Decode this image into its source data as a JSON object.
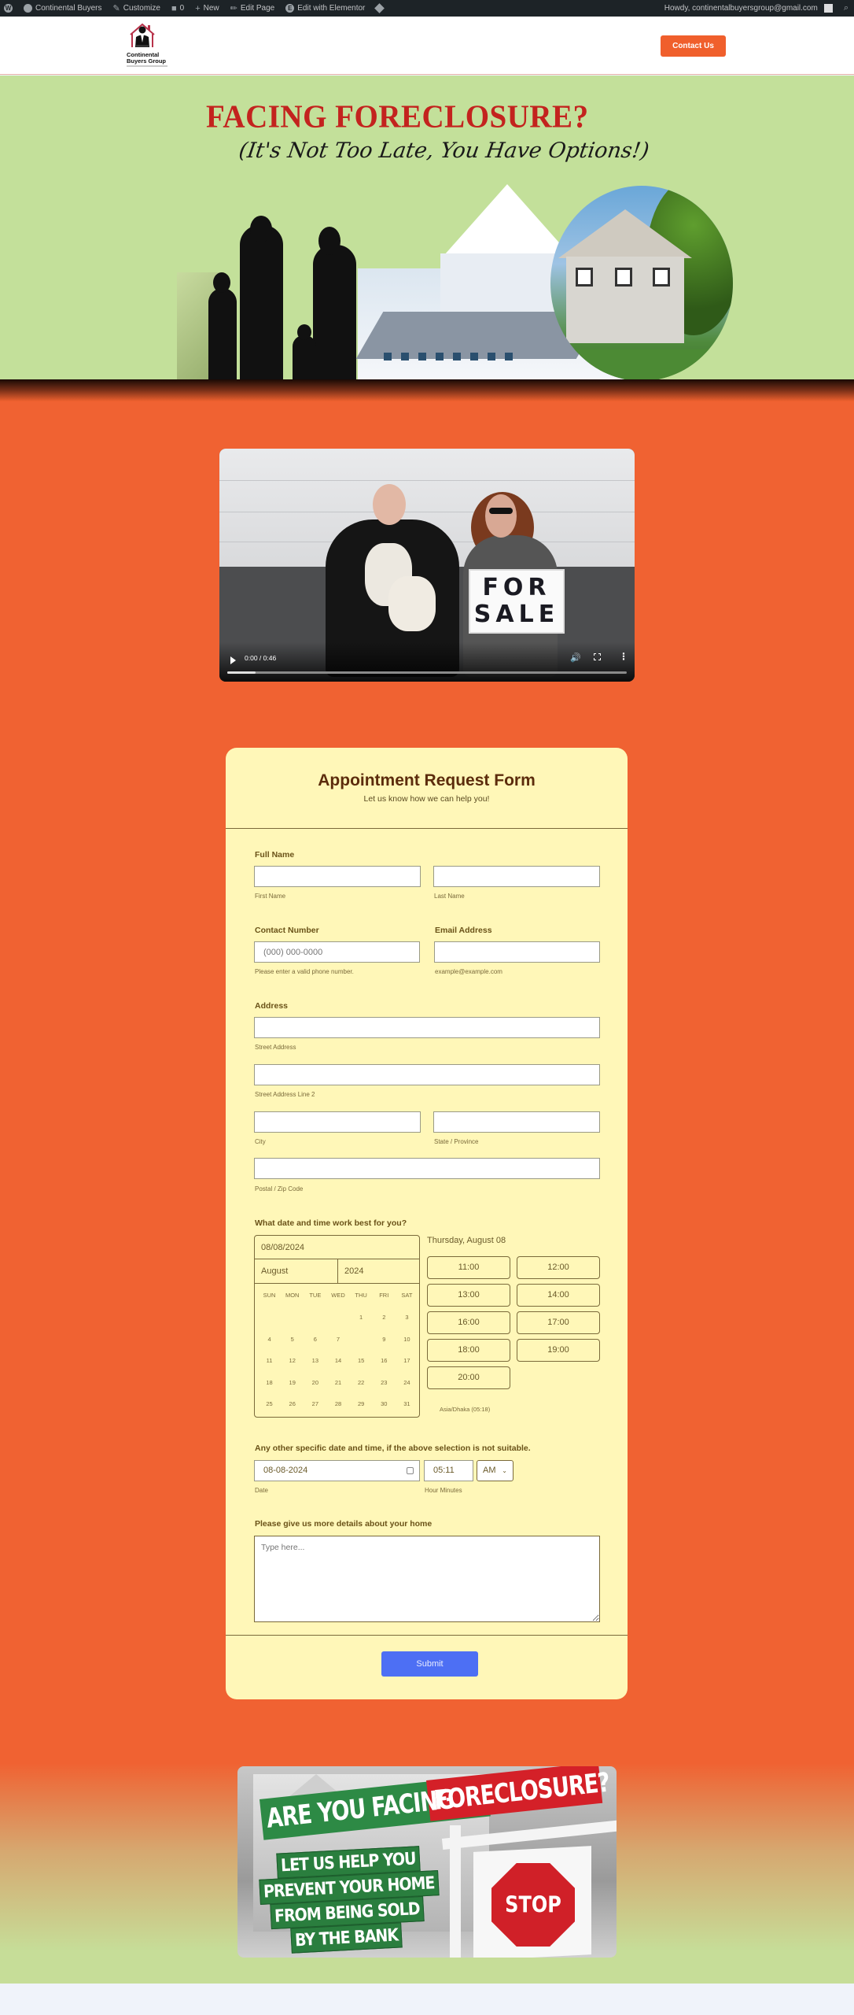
{
  "admin_bar": {
    "items": [
      {
        "icon": "wordpress-icon",
        "label": ""
      },
      {
        "icon": "dashboard-icon",
        "label": "Continental Buyers"
      },
      {
        "icon": "brush-icon",
        "label": "Customize"
      },
      {
        "icon": "comment-icon",
        "label": "0"
      },
      {
        "icon": "plus-icon",
        "label": "New"
      },
      {
        "icon": "pencil-icon",
        "label": "Edit Page"
      },
      {
        "icon": "elementor-icon",
        "label": "Edit with Elementor"
      },
      {
        "icon": "diamond-icon",
        "label": ""
      }
    ],
    "greeting": "Howdy, continentalbuyersgroup@gmail.com",
    "search_icon": "search-icon"
  },
  "header": {
    "logo_line1": "Continental",
    "logo_line2": "Buyers Group",
    "contact_button": "Contact Us"
  },
  "hero": {
    "title": "FACING FORECLOSURE?",
    "subtitle": "(It's Not Too Late, You Have Options!)"
  },
  "video": {
    "sign_line1": "FOR",
    "sign_line2": "SALE",
    "time": "0:00 / 0:46",
    "progress_fraction": 0.07
  },
  "form": {
    "title": "Appointment Request Form",
    "subtitle": "Let us know how we can help you!",
    "full_name": {
      "label": "Full Name",
      "first_sub": "First Name",
      "last_sub": "Last Name",
      "first_value": "",
      "last_value": ""
    },
    "contact": {
      "label": "Contact Number",
      "placeholder": "(000) 000-0000",
      "sub": "Please enter a valid phone number."
    },
    "email": {
      "label": "Email Address",
      "sub": "example@example.com"
    },
    "address": {
      "label": "Address",
      "street_sub": "Street Address",
      "street2_sub": "Street Address Line 2",
      "city_sub": "City",
      "state_sub": "State / Province",
      "zip_sub": "Postal / Zip Code"
    },
    "datetime": {
      "label": "What date and time work best for you?",
      "selected_date": "08/08/2024",
      "month": "August",
      "year": "2024",
      "weekdays": [
        "SUN",
        "MON",
        "TUE",
        "WED",
        "THU",
        "FRI",
        "SAT"
      ],
      "days": [
        "",
        "",
        "",
        "",
        "1",
        "2",
        "3",
        "4",
        "5",
        "6",
        "7",
        "",
        "9",
        "10",
        "11",
        "12",
        "13",
        "14",
        "15",
        "16",
        "17",
        "18",
        "19",
        "20",
        "21",
        "22",
        "23",
        "24",
        "25",
        "26",
        "27",
        "28",
        "29",
        "30",
        "31"
      ],
      "day_heading": "Thursday, August 08",
      "slots": [
        "11:00",
        "12:00",
        "13:00",
        "14:00",
        "16:00",
        "17:00",
        "18:00",
        "19:00",
        "20:00"
      ],
      "timezone": "Asia/Dhaka (05:18)"
    },
    "alt_datetime": {
      "label": "Any other specific date and time, if the above selection is not suitable.",
      "date_value": "08-08-2024",
      "date_sub": "Date",
      "time_value": "05:11",
      "time_sub": "Hour Minutes",
      "ampm": "AM"
    },
    "details": {
      "label": "Please give us more details about your home",
      "placeholder": "Type here..."
    },
    "submit": "Submit"
  },
  "banner": {
    "line_green": "ARE YOU FACING",
    "line_red": "FORECLOSURE?",
    "lines": [
      "LET US HELP YOU",
      "PREVENT YOUR HOME",
      "FROM BEING SOLD",
      "BY THE BANK"
    ],
    "stop": "STOP"
  }
}
